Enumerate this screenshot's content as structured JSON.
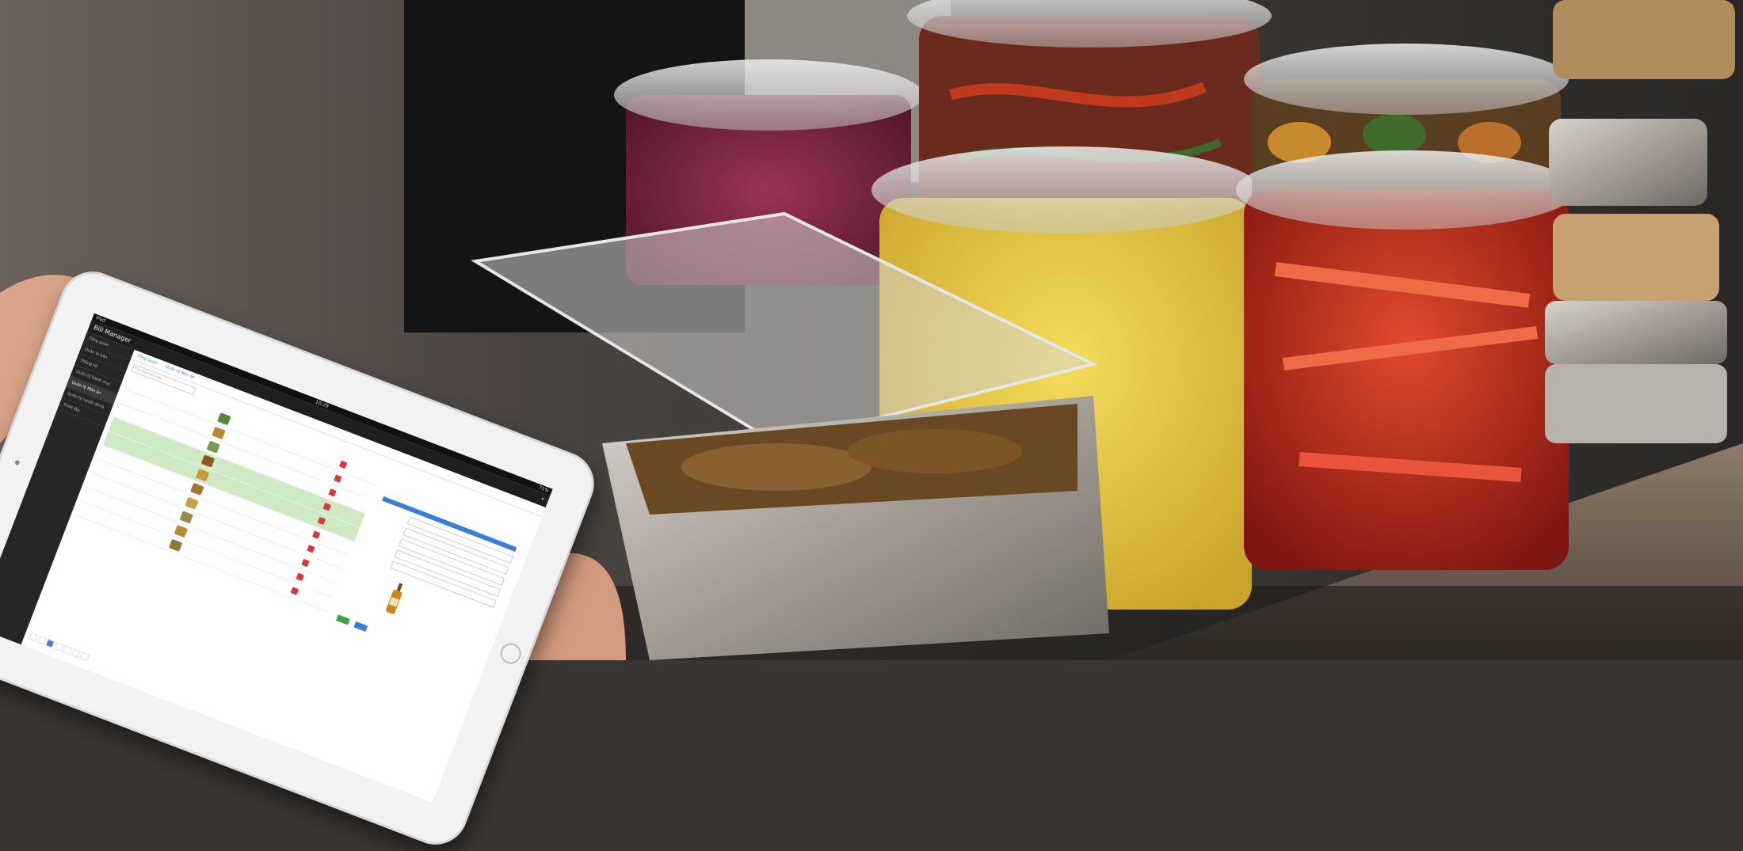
{
  "app": {
    "title": "Bill Manager",
    "clock": "10:29",
    "battery": "71%",
    "carrier": "iPad"
  },
  "sidebar": {
    "items": [
      {
        "label": "Tổng quan"
      },
      {
        "label": "Quản lý bàn"
      },
      {
        "label": "Thống kê"
      },
      {
        "label": "Quản lý Danh mục"
      },
      {
        "label": "Quản lý Món ăn"
      },
      {
        "label": "Quản lý người dùng"
      },
      {
        "label": "Thiết lập"
      }
    ]
  },
  "tabs": [
    {
      "label": "Tổng quan"
    },
    {
      "label": "Quản lý Món ăn"
    }
  ],
  "search": {
    "placeholder": "Tìm kiếm tên món"
  },
  "colors": {
    "accent": "#3b7dd8",
    "danger": "#d9383a",
    "selected_row": "#cfe9c4",
    "sidebar": "#262626"
  }
}
